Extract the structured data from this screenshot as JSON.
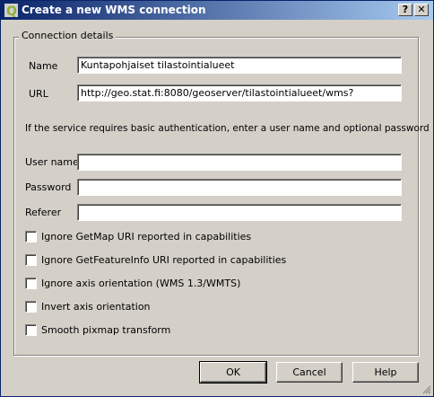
{
  "window": {
    "title": "Create a new WMS connection",
    "help_label": "?",
    "close_label": "✕"
  },
  "group": {
    "title": "Connection details"
  },
  "fields": {
    "name": {
      "label": "Name",
      "value": "Kuntapohjaiset tilastointialueet"
    },
    "url": {
      "label": "URL",
      "value": "http://geo.stat.fi:8080/geoserver/tilastointialueet/wms?"
    },
    "info": "If the service requires basic authentication, enter a user name and optional password",
    "username": {
      "label": "User name",
      "value": ""
    },
    "password": {
      "label": "Password",
      "value": ""
    },
    "referer": {
      "label": "Referer",
      "value": ""
    }
  },
  "options": [
    {
      "label": "Ignore GetMap URI reported in capabilities",
      "checked": false
    },
    {
      "label": "Ignore GetFeatureInfo URI reported in capabilities",
      "checked": false
    },
    {
      "label": "Ignore axis orientation (WMS 1.3/WMTS)",
      "checked": false
    },
    {
      "label": "Invert axis orientation",
      "checked": false
    },
    {
      "label": "Smooth pixmap transform",
      "checked": false
    }
  ],
  "buttons": {
    "ok": "OK",
    "cancel": "Cancel",
    "help": "Help"
  },
  "icons": {
    "app": "qgis-icon",
    "resize": "resize-grip-icon"
  },
  "colors": {
    "titlebar_start": "#0a246a",
    "titlebar_end": "#a6caf0",
    "dialog_bg": "#d4d0c8",
    "app_icon": "#8bb33a"
  }
}
